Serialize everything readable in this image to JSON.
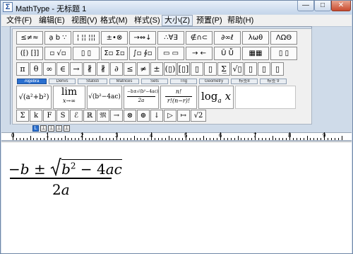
{
  "window": {
    "title": "MathType - 无标题 1",
    "min_label": "—",
    "max_label": "□",
    "close_label": "✕"
  },
  "menu": [
    "文件(F)",
    "编辑(E)",
    "视图(V)",
    "格式(M)",
    "样式(S)",
    "大小(Z)",
    "预置(P)",
    "帮助(H)"
  ],
  "row1": [
    "≤≠≈",
    "ạ b ∵",
    "¦ ¦¦ ¦¦¦",
    "±•⊗",
    "→⇔↓",
    "∴∀∃",
    "∉∩⊂",
    "∂∞ℓ",
    "λωθ",
    "ΛΩΘ"
  ],
  "row2": [
    "(⁅) [⁆]",
    "▫ √▫",
    "▯ ▯",
    "Σ▫ Σ▫",
    "∫▫ ∮▫",
    "▭ ▭",
    "→ ←",
    "Ū Ṻ",
    "▦▦",
    "▯ ▯"
  ],
  "row3": [
    "π",
    "θ",
    "∞",
    "∈",
    "→",
    "∦",
    "∦",
    "∂",
    "≤",
    "≠",
    "±",
    "(▯)",
    "[▯]",
    "▯",
    "▯",
    "Σ̲",
    "√▯",
    "▯",
    "▯",
    "▯"
  ],
  "tabs": [
    "Algebra",
    "Derivs",
    "Statisti",
    "Matrices",
    "Sets",
    "Trig",
    "Geometry",
    "标签8",
    "标签 9"
  ],
  "templates": {
    "t1": "√(a²+b²)",
    "t2_top": "lim",
    "t2_bot": "x→∞",
    "t3": "√(b²−4ac)",
    "t4_top": "−b±√(b²−4ac)",
    "t4_bot": "2a",
    "t5_top": "n!",
    "t5_bot": "r!(n−r)!",
    "t6": "log",
    "t6_sub": "a",
    "t6_arg": "x"
  },
  "row5": [
    "Σ",
    "k",
    "F",
    "S",
    "ℰ",
    "ℝ",
    "𝔐",
    "→",
    "⊗",
    "⊕",
    "↓",
    "▷",
    "↦",
    "√2"
  ],
  "tabstops": [
    "L",
    "⊥",
    "⊥",
    "⊥",
    "⊥"
  ],
  "ruler": {
    "labels": [
      "0",
      "1",
      "2",
      "3",
      "4",
      "5",
      "6",
      "7",
      "8",
      "9"
    ]
  },
  "equation": {
    "minus": "−",
    "b": "b",
    "pm": "±",
    "b2": "b",
    "exp": "2",
    "minus2": "−",
    "four": "4",
    "ac": "ac",
    "den_num": "2",
    "den_var": "a"
  }
}
